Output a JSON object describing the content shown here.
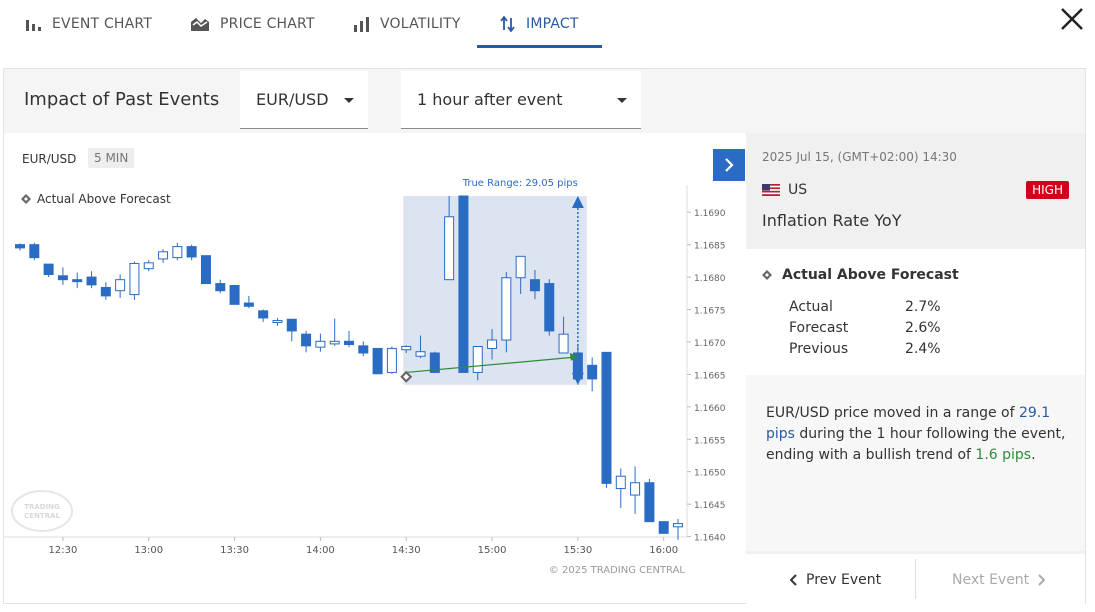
{
  "tabs": [
    {
      "label": "EVENT CHART",
      "icon": "bar-chart-icon"
    },
    {
      "label": "PRICE CHART",
      "icon": "price-chart-icon"
    },
    {
      "label": "VOLATILITY",
      "icon": "volatility-icon"
    },
    {
      "label": "IMPACT",
      "icon": "impact-icon"
    }
  ],
  "active_tab": "IMPACT",
  "toolbar": {
    "title": "Impact of Past Events",
    "pair": "EUR/USD",
    "timeframe": "1 hour after event"
  },
  "chart_header": {
    "symbol": "EUR/USD",
    "interval": "5 MIN"
  },
  "chart_legend": "Actual Above Forecast",
  "copyright": "© 2025 TRADING CENTRAL",
  "watermark": "TRADING CENTRAL",
  "chart_data": {
    "type": "candlestick",
    "x_ticks": [
      "12:30",
      "13:00",
      "13:30",
      "14:00",
      "14:30",
      "15:00",
      "15:30",
      "16:00"
    ],
    "y_ticks": [
      "1.1690",
      "1.1685",
      "1.1680",
      "1.1675",
      "1.1670",
      "1.1665",
      "1.1660",
      "1.1655",
      "1.1650",
      "1.1645",
      "1.1640"
    ],
    "ylim": [
      1.16387,
      1.16925
    ],
    "xlim": [
      "12:15",
      "16:05"
    ],
    "event_time": "14:30",
    "window_end": "15:30",
    "range_label": "True Range: 29.05 pips",
    "trend_line": {
      "start": [
        "14:30",
        1.16653
      ],
      "end": [
        "15:30",
        1.16677
      ]
    },
    "up_color": "#ffffff",
    "down_color": "#2a6cc4",
    "highlight_color": "#dce3f1",
    "candles": [
      {
        "t": "12:15",
        "o": 1.1685,
        "h": 1.16852,
        "l": 1.16841,
        "c": 1.16845
      },
      {
        "t": "12:20",
        "o": 1.1685,
        "h": 1.16853,
        "l": 1.16826,
        "c": 1.1683
      },
      {
        "t": "12:25",
        "o": 1.1682,
        "h": 1.1682,
        "l": 1.168,
        "c": 1.16804
      },
      {
        "t": "12:30",
        "o": 1.16802,
        "h": 1.16815,
        "l": 1.16788,
        "c": 1.16796
      },
      {
        "t": "12:35",
        "o": 1.16796,
        "h": 1.16807,
        "l": 1.16783,
        "c": 1.16793
      },
      {
        "t": "12:40",
        "o": 1.168,
        "h": 1.16809,
        "l": 1.16783,
        "c": 1.16788
      },
      {
        "t": "12:45",
        "o": 1.16784,
        "h": 1.16792,
        "l": 1.16765,
        "c": 1.16771
      },
      {
        "t": "12:50",
        "o": 1.16779,
        "h": 1.16804,
        "l": 1.16768,
        "c": 1.16796
      },
      {
        "t": "12:55",
        "o": 1.16773,
        "h": 1.16824,
        "l": 1.16765,
        "c": 1.16821
      },
      {
        "t": "13:00",
        "o": 1.16813,
        "h": 1.16826,
        "l": 1.16809,
        "c": 1.16822
      },
      {
        "t": "13:05",
        "o": 1.16828,
        "h": 1.16843,
        "l": 1.16822,
        "c": 1.16839
      },
      {
        "t": "13:10",
        "o": 1.1683,
        "h": 1.16853,
        "l": 1.16826,
        "c": 1.16847
      },
      {
        "t": "13:15",
        "o": 1.16847,
        "h": 1.1685,
        "l": 1.16826,
        "c": 1.16831
      },
      {
        "t": "13:20",
        "o": 1.16833,
        "h": 1.16833,
        "l": 1.1679,
        "c": 1.1679
      },
      {
        "t": "13:25",
        "o": 1.1679,
        "h": 1.16796,
        "l": 1.16775,
        "c": 1.16779
      },
      {
        "t": "13:30",
        "o": 1.16787,
        "h": 1.16787,
        "l": 1.16758,
        "c": 1.16758
      },
      {
        "t": "13:35",
        "o": 1.1676,
        "h": 1.16771,
        "l": 1.16752,
        "c": 1.16755
      },
      {
        "t": "13:40",
        "o": 1.16748,
        "h": 1.1675,
        "l": 1.16731,
        "c": 1.16737
      },
      {
        "t": "13:45",
        "o": 1.1673,
        "h": 1.16737,
        "l": 1.16725,
        "c": 1.16733
      },
      {
        "t": "13:50",
        "o": 1.16735,
        "h": 1.16735,
        "l": 1.16701,
        "c": 1.16717
      },
      {
        "t": "13:55",
        "o": 1.16712,
        "h": 1.16717,
        "l": 1.16684,
        "c": 1.16694
      },
      {
        "t": "14:00",
        "o": 1.16692,
        "h": 1.16713,
        "l": 1.16685,
        "c": 1.16701
      },
      {
        "t": "14:05",
        "o": 1.16697,
        "h": 1.16736,
        "l": 1.16694,
        "c": 1.16701
      },
      {
        "t": "14:10",
        "o": 1.16701,
        "h": 1.16717,
        "l": 1.16692,
        "c": 1.16696
      },
      {
        "t": "14:15",
        "o": 1.16694,
        "h": 1.16701,
        "l": 1.16678,
        "c": 1.16683
      },
      {
        "t": "14:20",
        "o": 1.1669,
        "h": 1.1669,
        "l": 1.16651,
        "c": 1.16651
      },
      {
        "t": "14:25",
        "o": 1.16653,
        "h": 1.16693,
        "l": 1.16651,
        "c": 1.1669
      },
      {
        "t": "14:30",
        "o": 1.16688,
        "h": 1.16695,
        "l": 1.16683,
        "c": 1.16693
      },
      {
        "t": "14:35",
        "o": 1.16678,
        "h": 1.1671,
        "l": 1.16675,
        "c": 1.16685
      },
      {
        "t": "14:40",
        "o": 1.16683,
        "h": 1.16685,
        "l": 1.16653,
        "c": 1.16653
      },
      {
        "t": "14:45",
        "o": 1.16796,
        "h": 1.16925,
        "l": 1.16796,
        "c": 1.16893
      },
      {
        "t": "14:50",
        "o": 1.16925,
        "h": 1.16925,
        "l": 1.16653,
        "c": 1.16653
      },
      {
        "t": "14:55",
        "o": 1.16653,
        "h": 1.1669,
        "l": 1.16641,
        "c": 1.16693
      },
      {
        "t": "15:00",
        "o": 1.1669,
        "h": 1.1672,
        "l": 1.16673,
        "c": 1.16703
      },
      {
        "t": "15:05",
        "o": 1.16703,
        "h": 1.16808,
        "l": 1.16684,
        "c": 1.16799
      },
      {
        "t": "15:10",
        "o": 1.16799,
        "h": 1.16832,
        "l": 1.16774,
        "c": 1.16832
      },
      {
        "t": "15:15",
        "o": 1.16796,
        "h": 1.16811,
        "l": 1.16766,
        "c": 1.16779
      },
      {
        "t": "15:20",
        "o": 1.1679,
        "h": 1.16797,
        "l": 1.1671,
        "c": 1.16717
      },
      {
        "t": "15:25",
        "o": 1.16683,
        "h": 1.16739,
        "l": 1.16683,
        "c": 1.16712
      },
      {
        "t": "15:30",
        "o": 1.16683,
        "h": 1.16697,
        "l": 1.16634,
        "c": 1.16643
      },
      {
        "t": "15:35",
        "o": 1.16664,
        "h": 1.16676,
        "l": 1.16624,
        "c": 1.16643
      },
      {
        "t": "15:40",
        "o": 1.16684,
        "h": 1.16684,
        "l": 1.16475,
        "c": 1.16482
      },
      {
        "t": "15:45",
        "o": 1.16474,
        "h": 1.16505,
        "l": 1.16444,
        "c": 1.16493
      },
      {
        "t": "15:50",
        "o": 1.16464,
        "h": 1.16508,
        "l": 1.16435,
        "c": 1.16483
      },
      {
        "t": "15:55",
        "o": 1.16483,
        "h": 1.16489,
        "l": 1.16423,
        "c": 1.16423
      },
      {
        "t": "16:00",
        "o": 1.16423,
        "h": 1.16423,
        "l": 1.16405,
        "c": 1.16405
      },
      {
        "t": "16:05",
        "o": 1.16415,
        "h": 1.16427,
        "l": 1.16395,
        "c": 1.1642
      }
    ]
  },
  "side": {
    "date": "2025 Jul 15, (GMT+02:00) 14:30",
    "country": "US",
    "impact": "HIGH",
    "event": "Inflation Rate YoY",
    "forecast_title": "Actual Above Forecast",
    "rows": [
      {
        "label": "Actual",
        "value": "2.7%"
      },
      {
        "label": "Forecast",
        "value": "2.6%"
      },
      {
        "label": "Previous",
        "value": "2.4%"
      }
    ],
    "summary": {
      "p1": "EUR/USD price moved in a range of ",
      "range": "29.1 pips",
      "p2": " during the 1 hour following the event, ending with a bullish trend of ",
      "trend": "1.6 pips",
      "p3": "."
    },
    "prev_label": "Prev Event",
    "next_label": "Next Event"
  }
}
